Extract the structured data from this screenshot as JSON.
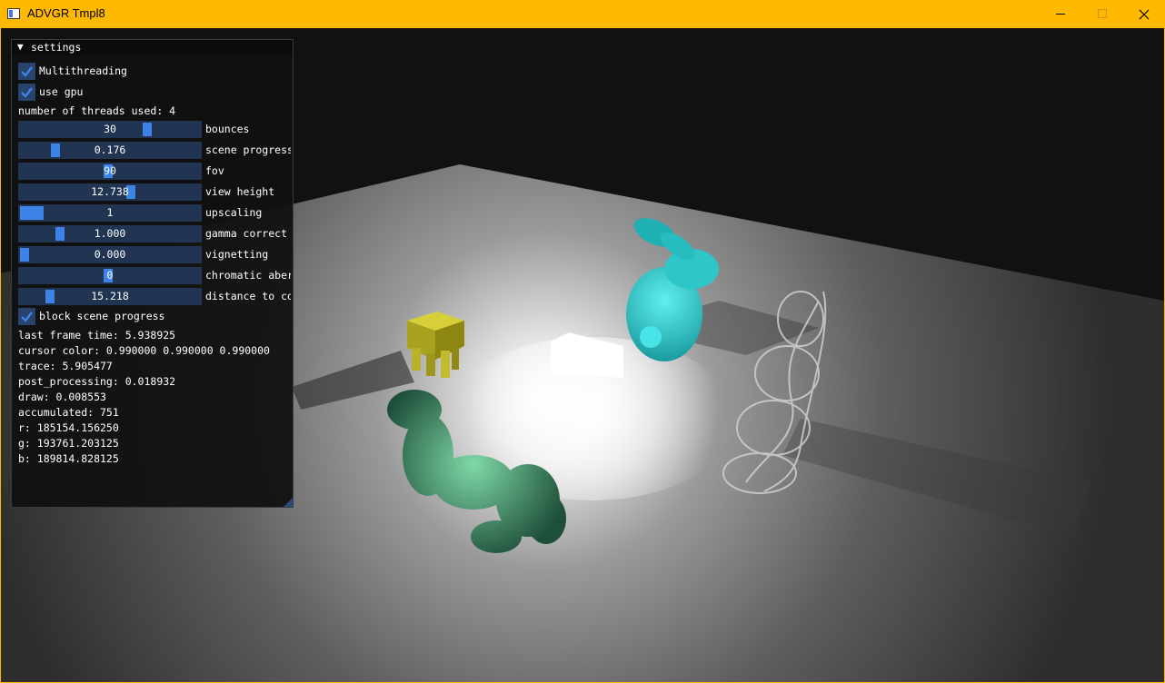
{
  "window": {
    "title": "ADVGR Tmpl8",
    "titlebar_color": "#ffb900",
    "minimize_icon": "minimize-icon",
    "maximize_icon": "maximize-icon",
    "close_icon": "close-icon"
  },
  "panel": {
    "title": "settings",
    "collapse_icon": "triangle-down-icon",
    "checkboxes": {
      "multithreading": {
        "label": "Multithreading",
        "checked": true
      },
      "use_gpu": {
        "label": "use gpu",
        "checked": true
      },
      "block_scene_progress": {
        "label": "block scene progress",
        "checked": true
      }
    },
    "threads_text": "number of threads used: 4",
    "sliders": [
      {
        "label": "bounces",
        "value": "30",
        "fill": 0.72
      },
      {
        "label": "scene progress",
        "value": "0.176",
        "fill": 0.18
      },
      {
        "label": "fov",
        "value": "90",
        "fill": 0.49
      },
      {
        "label": "view height",
        "value": "12.738",
        "fill": 0.62
      },
      {
        "label": "upscaling",
        "value": "1",
        "fill": 0.0
      },
      {
        "label": "gamma correct",
        "value": "1.000",
        "fill": 0.21
      },
      {
        "label": "vignetting",
        "value": "0.000",
        "fill": 0.0
      },
      {
        "label": "chromatic aber",
        "value": "0",
        "fill": 0.49
      },
      {
        "label": "distance to co",
        "value": "15.218",
        "fill": 0.15
      }
    ],
    "stats": {
      "last_frame_time": "last frame time: 5.938925",
      "cursor_color": "cursor color: 0.990000 0.990000 0.990000",
      "trace": "trace: 5.905477",
      "post_processing": "post_processing: 0.018932",
      "draw": "draw: 0.008553",
      "accumulated": "accumulated: 751",
      "r": "r: 185154.156250",
      "g": "g: 193761.203125",
      "b": "b: 189814.828125"
    }
  },
  "colors": {
    "slider_bg": "#213452",
    "slider_grab": "#3d84e6",
    "checkbox_bg": "#29446c"
  }
}
